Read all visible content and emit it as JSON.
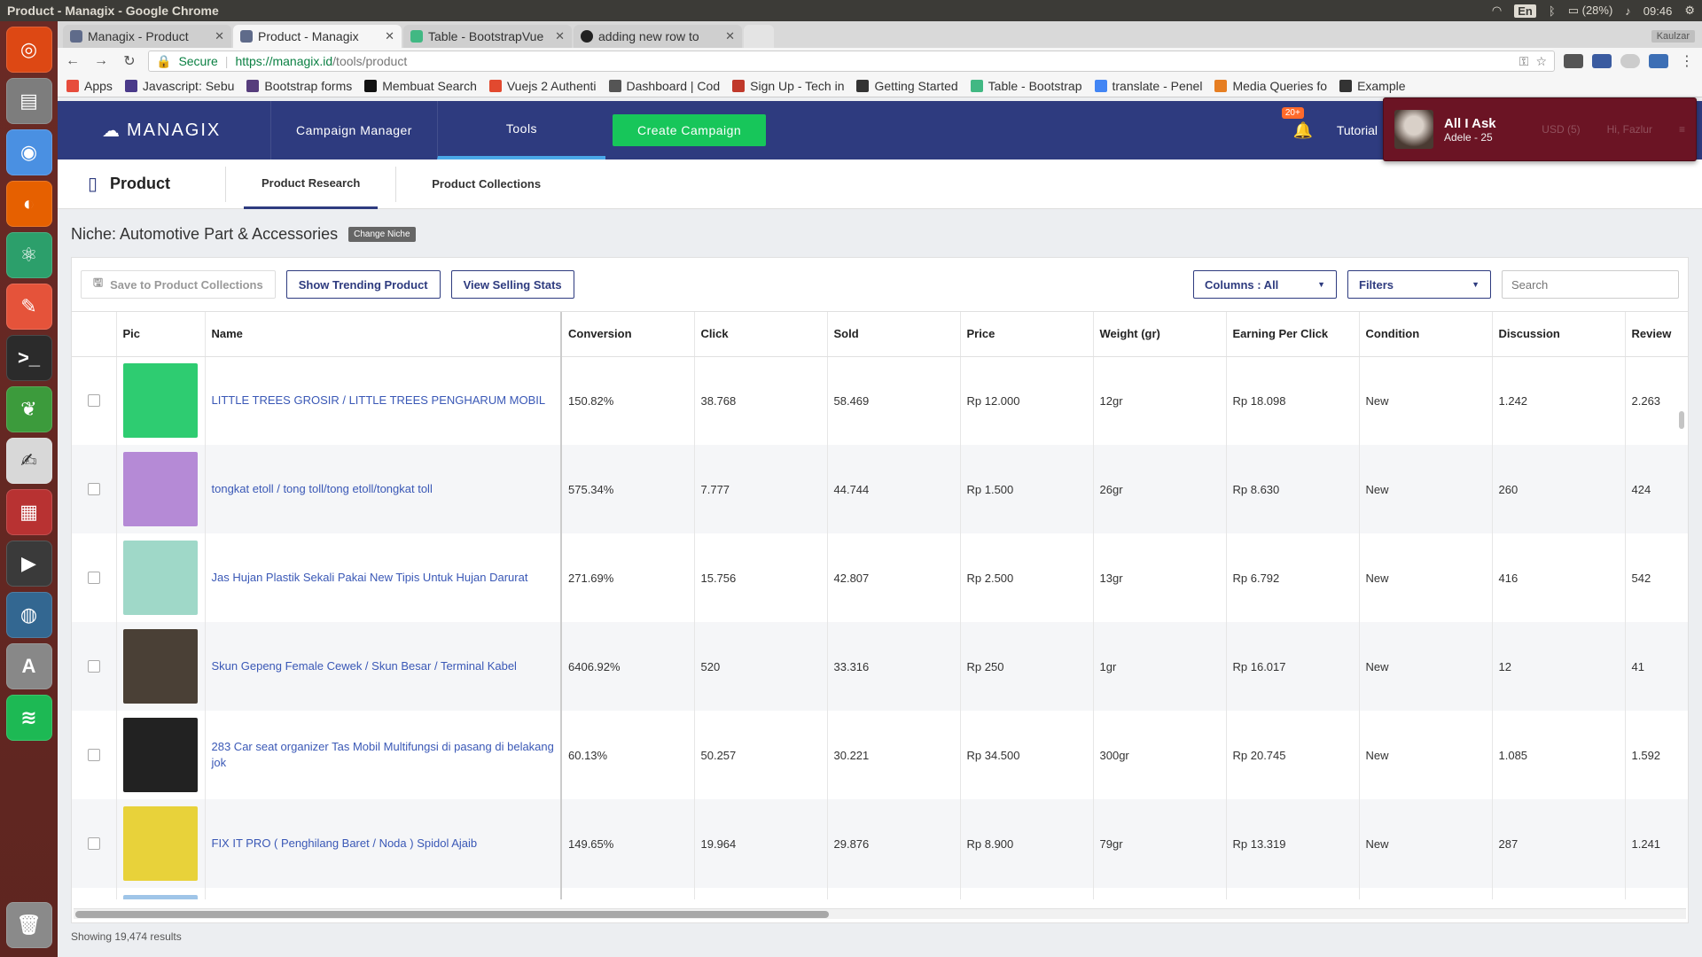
{
  "os": {
    "window_title": "Product - Managix - Google Chrome",
    "lang": "En",
    "battery": "(28%)",
    "clock": "09:46"
  },
  "browser": {
    "tabs": [
      {
        "label": "Managix - Product",
        "color": "#5f6b8a"
      },
      {
        "label": "Product - Managix",
        "color": "#5f6b8a"
      },
      {
        "label": "Table - BootstrapVue",
        "color": "#41b883"
      },
      {
        "label": "adding new row to",
        "color": "#222222"
      }
    ],
    "profile": "Kaulzar",
    "secure_label": "Secure",
    "url_host": "https://managix.id",
    "url_path": "/tools/product",
    "bookmarks": [
      {
        "label": "Apps",
        "color": "#e74c3c"
      },
      {
        "label": "Javascript: Sebu",
        "color": "#4a3a8a"
      },
      {
        "label": "Bootstrap forms",
        "color": "#563d7c"
      },
      {
        "label": "Membuat Search",
        "color": "#111111"
      },
      {
        "label": "Vuejs 2 Authenti",
        "color": "#e2492f"
      },
      {
        "label": "Dashboard | Cod",
        "color": "#555555"
      },
      {
        "label": "Sign Up - Tech in",
        "color": "#c0392b"
      },
      {
        "label": "Getting Started",
        "color": "#333333"
      },
      {
        "label": "Table - Bootstrap",
        "color": "#41b883"
      },
      {
        "label": "translate - Penel",
        "color": "#4285f4"
      },
      {
        "label": "Media Queries fo",
        "color": "#e67e22"
      },
      {
        "label": "Example",
        "color": "#333333"
      }
    ]
  },
  "app": {
    "logo": "MANAGIX",
    "nav": {
      "campaign_manager": "Campaign Manager",
      "tools": "Tools",
      "create_campaign": "Create Campaign",
      "notif_badge": "20+",
      "tutorial": "Tutorial"
    },
    "song_popup": {
      "title": "All I Ask",
      "artist": "Adele - 25",
      "hidden_balance": "USD (5)",
      "hidden_user": "Hi, Fazlur"
    },
    "subnav": {
      "page_title": "Product",
      "tab_research": "Product Research",
      "tab_collections": "Product Collections"
    },
    "niche": {
      "label": "Niche: Automotive Part & Accessories",
      "change": "Change Niche"
    },
    "toolbar": {
      "save": "Save to Product Collections",
      "trending": "Show Trending Product",
      "selling_stats": "View Selling Stats",
      "columns": "Columns : All",
      "filters": "Filters",
      "search_placeholder": "Search"
    },
    "columns": [
      "Pic",
      "Name",
      "Conversion",
      "Click",
      "Sold",
      "Price",
      "Weight (gr)",
      "Earning Per Click",
      "Condition",
      "Discussion",
      "Review"
    ],
    "rows": [
      {
        "name": "LITTLE TREES GROSIR / LITTLE TREES PENGHARUM MOBIL",
        "conversion": "150.82%",
        "click": "38.768",
        "sold": "58.469",
        "price": "Rp 12.000",
        "weight": "12gr",
        "epc": "Rp 18.098",
        "condition": "New",
        "discussion": "1.242",
        "review": "2.263",
        "pic_color": "#2ecc71",
        "pic_icon": "air-freshener-image"
      },
      {
        "name": "tongkat etoll / tong toll/tong etoll/tongkat toll",
        "conversion": "575.34%",
        "click": "7.777",
        "sold": "44.744",
        "price": "Rp 1.500",
        "weight": "26gr",
        "epc": "Rp 8.630",
        "condition": "New",
        "discussion": "260",
        "review": "424",
        "pic_color": "#b58ad6",
        "pic_icon": "toll-stick-image"
      },
      {
        "name": "Jas Hujan Plastik Sekali Pakai New Tipis Untuk Hujan Darurat",
        "conversion": "271.69%",
        "click": "15.756",
        "sold": "42.807",
        "price": "Rp 2.500",
        "weight": "13gr",
        "epc": "Rp 6.792",
        "condition": "New",
        "discussion": "416",
        "review": "542",
        "pic_color": "#9fd8c8",
        "pic_icon": "raincoat-image"
      },
      {
        "name": "Skun Gepeng Female Cewek / Skun Besar / Terminal Kabel",
        "conversion": "6406.92%",
        "click": "520",
        "sold": "33.316",
        "price": "Rp 250",
        "weight": "1gr",
        "epc": "Rp 16.017",
        "condition": "New",
        "discussion": "12",
        "review": "41",
        "pic_color": "#4a4036",
        "pic_icon": "terminal-connector-image"
      },
      {
        "name": "283 Car seat organizer Tas Mobil Multifungsi di pasang di belakang jok",
        "conversion": "60.13%",
        "click": "50.257",
        "sold": "30.221",
        "price": "Rp 34.500",
        "weight": "300gr",
        "epc": "Rp 20.745",
        "condition": "New",
        "discussion": "1.085",
        "review": "1.592",
        "pic_color": "#222222",
        "pic_icon": "seat-organizer-image"
      },
      {
        "name": "FIX IT PRO ( Penghilang Baret / Noda ) Spidol Ajaib",
        "conversion": "149.65%",
        "click": "19.964",
        "sold": "29.876",
        "price": "Rp 8.900",
        "weight": "79gr",
        "epc": "Rp 13.319",
        "condition": "New",
        "discussion": "287",
        "review": "1.241",
        "pic_color": "#e8d23a",
        "pic_icon": "fix-it-pro-image"
      },
      {
        "name": "",
        "conversion": "",
        "click": "",
        "sold": "",
        "price": "",
        "weight": "",
        "epc": "",
        "condition": "",
        "discussion": "",
        "review": "",
        "pic_color": "#9fc5e8",
        "pic_icon": "product-image"
      }
    ],
    "footer": "Showing 19,474 results"
  }
}
